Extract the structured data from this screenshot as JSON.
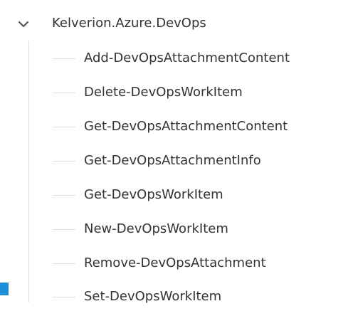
{
  "tree": {
    "root": {
      "label": "Kelverion.Azure.DevOps",
      "expanded": true,
      "icon": "chevron-down-icon"
    },
    "items": [
      {
        "label": "Add-DevOpsAttachmentContent"
      },
      {
        "label": "Delete-DevOpsWorkItem"
      },
      {
        "label": "Get-DevOpsAttachmentContent"
      },
      {
        "label": "Get-DevOpsAttachmentInfo"
      },
      {
        "label": "Get-DevOpsWorkItem"
      },
      {
        "label": "New-DevOpsWorkItem"
      },
      {
        "label": "Remove-DevOpsAttachment"
      },
      {
        "label": "Set-DevOpsWorkItem"
      }
    ]
  },
  "colors": {
    "text": "#333333",
    "connector": "#dcdcdc",
    "accent": "#1e8fd6"
  }
}
